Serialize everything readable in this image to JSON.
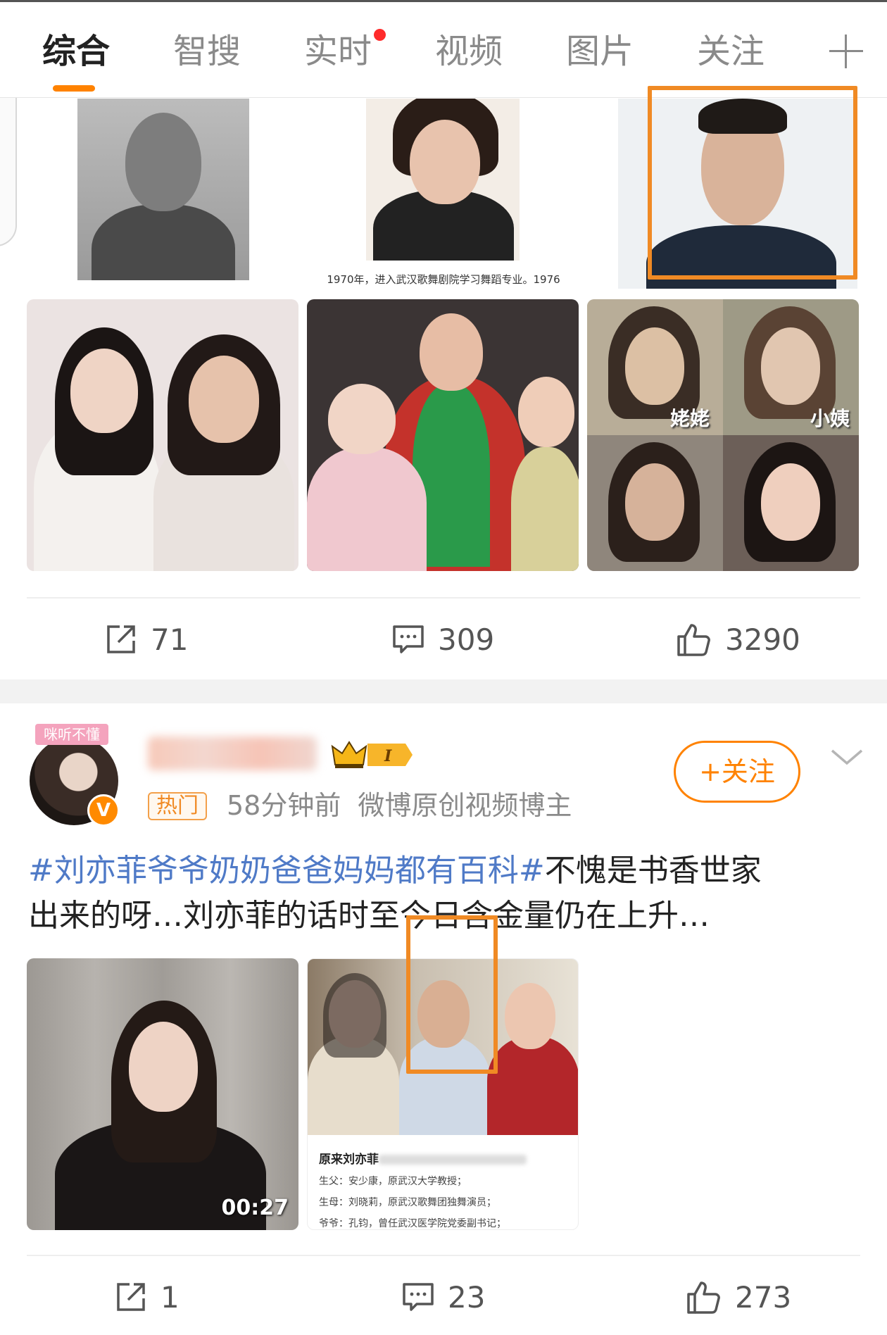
{
  "tabs": [
    {
      "label": "综合",
      "active": true
    },
    {
      "label": "智搜",
      "active": false
    },
    {
      "label": "实时",
      "active": false,
      "dot": true
    },
    {
      "label": "视频",
      "active": false
    },
    {
      "label": "图片",
      "active": false
    },
    {
      "label": "关注",
      "active": false
    }
  ],
  "colors": {
    "accent": "#ff8200",
    "topic_link": "#4f7ac7",
    "highlight": "#f08a24",
    "red_dot": "#ff2b2b"
  },
  "post1": {
    "image_caption": "1970年，进入武汉歌舞剧院学习舞蹈专业。1976",
    "grid3_labels": {
      "top_left": "姥姥",
      "top_right": "小姨"
    },
    "actions": {
      "share": "71",
      "comment": "309",
      "like": "3290"
    }
  },
  "post2": {
    "avatar_tag": "咪听不懂",
    "verified_badge": "V",
    "hot_badge": "热门",
    "time": "58分钟前",
    "source": "微博原创视频博主",
    "follow_label": "+关注",
    "topic": "#刘亦菲爷爷奶奶爸爸妈妈都有百科#",
    "text_line1_rest": "不愧是书香世家",
    "text_line2": "出来的呀…刘亦菲的话时至今日含金量仍在上升…",
    "video_duration": "00:27",
    "family_card": {
      "title": "原来刘亦菲",
      "lines": [
        "生父：安少康，原武汉大学教授；",
        "生母：刘晓莉，原武汉歌舞团独舞演员；",
        "爷爷：孔钧，曾任武汉医学院党委副书记；"
      ]
    },
    "actions": {
      "share": "1",
      "comment": "23",
      "like": "273"
    }
  },
  "icons": {
    "share": "share-icon",
    "comment": "comment-icon",
    "like": "thumbs-up-icon",
    "plus": "plus-icon",
    "chevron": "chevron-down-icon",
    "crown": "crown-badge-icon"
  }
}
